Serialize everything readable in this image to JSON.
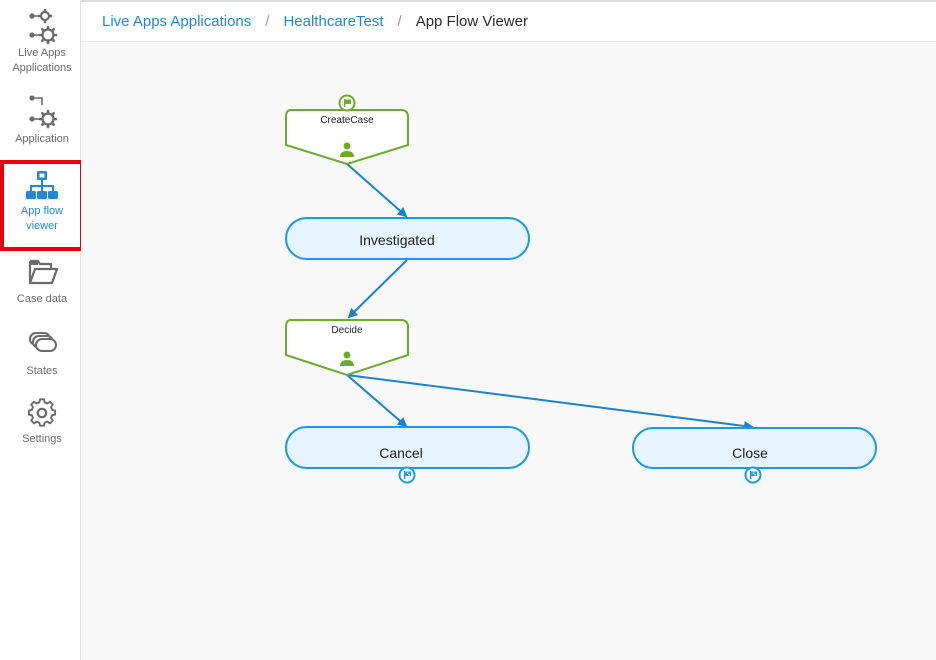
{
  "sidebar": {
    "items": [
      {
        "label_line1": "Live Apps",
        "label_line2": "Applications",
        "icon": "live-apps-gears-icon",
        "active": false
      },
      {
        "label_line1": "Application",
        "label_line2": "",
        "icon": "application-gear-icon",
        "active": false
      },
      {
        "label_line1": "App flow",
        "label_line2": "viewer",
        "icon": "sitemap-icon",
        "active": true
      },
      {
        "label_line1": "Case data",
        "label_line2": "",
        "icon": "folder-open-icon",
        "active": false
      },
      {
        "label_line1": "States",
        "label_line2": "",
        "icon": "stacked-states-icon",
        "active": false
      },
      {
        "label_line1": "Settings",
        "label_line2": "",
        "icon": "gear-icon",
        "active": false
      }
    ]
  },
  "breadcrumb": {
    "items": [
      "Live Apps Applications",
      "HealthcareTest",
      "App Flow Viewer"
    ],
    "separator": "/"
  },
  "flow": {
    "colors": {
      "process_border": "#6aab2e",
      "state_border": "#1a9ae6",
      "state_fill": "#e6f5fd",
      "connector": "#1a82cc",
      "highlight": "#e8000b"
    },
    "nodes": [
      {
        "id": "createcase",
        "type": "action",
        "label": "CreateCase",
        "start_flag": true
      },
      {
        "id": "investigated",
        "type": "state",
        "label": "Investigated"
      },
      {
        "id": "decide",
        "type": "action",
        "label": "Decide"
      },
      {
        "id": "cancel",
        "type": "state",
        "label": "Cancel",
        "end_flag": true
      },
      {
        "id": "close",
        "type": "state",
        "label": "Close",
        "end_flag": true
      }
    ],
    "edges": [
      {
        "from": "createcase",
        "to": "investigated"
      },
      {
        "from": "investigated",
        "to": "decide"
      },
      {
        "from": "decide",
        "to": "cancel"
      },
      {
        "from": "decide",
        "to": "close"
      }
    ]
  }
}
